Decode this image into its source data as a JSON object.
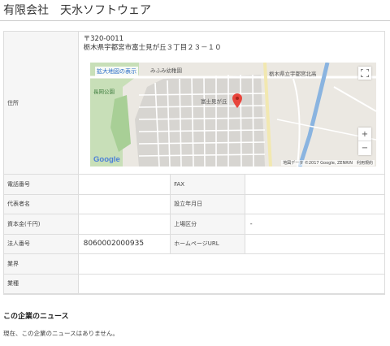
{
  "company": {
    "name": "有限会社　天水ソフトウェア"
  },
  "address": {
    "label": "住所",
    "postal": "〒320-0011",
    "line": "栃木県宇都宮市富士見が丘３丁目２３－１０"
  },
  "map": {
    "link_label": "拡大地図の表示",
    "places": [
      "みふみ幼稚園",
      "栃木県立宇都宮北高",
      "長岡公園",
      "富士見が丘"
    ],
    "zoom_in": "+",
    "zoom_out": "−",
    "logo": "Google",
    "attribution": "地図データ ©2017 Google, ZENRIN　利用規約",
    "icons": [
      "fullscreen-icon",
      "map-pin-icon"
    ]
  },
  "fields": {
    "phone_label": "電話番号",
    "phone_value": "",
    "fax_label": "FAX",
    "fax_value": "",
    "rep_label": "代表者名",
    "rep_value": "",
    "founded_label": "設立年月日",
    "founded_value": "",
    "capital_label": "資本金(千円)",
    "capital_value": "",
    "listing_label": "上場区分",
    "listing_value": "-",
    "corp_label": "法人番号",
    "corp_value": "8060002000935",
    "homepage_label": "ホームページURL",
    "homepage_value": "",
    "industry_label": "業界",
    "industry_value": "",
    "type_label": "業種",
    "type_value": ""
  },
  "news": {
    "heading": "この企業のニュース",
    "empty_text": "現在、この企業のニュースはありません。"
  }
}
